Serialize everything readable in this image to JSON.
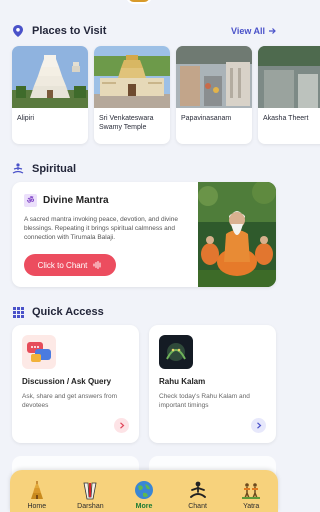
{
  "places_section": {
    "title": "Places to Visit",
    "view_all": "View All"
  },
  "places": [
    {
      "name": "Alipiri"
    },
    {
      "name": "Sri Venkateswara Swamy Temple"
    },
    {
      "name": "Papavinasanam"
    },
    {
      "name": "Akasha Theert"
    }
  ],
  "spiritual": {
    "title": "Spiritual",
    "mantra_title": "Divine Mantra",
    "om_symbol": "ॐ",
    "description": "A sacred mantra invoking peace, devotion, and divine blessings. Repeating it brings spiritual calmness and connection with Tirumala Balaji.",
    "button": "Click to Chant"
  },
  "quick_access": {
    "title": "Quick Access",
    "cards": [
      {
        "title": "Discussion / Ask Query",
        "desc": "Ask, share and get answers from devotees"
      },
      {
        "title": "Rahu Kalam",
        "desc": "Check today's Rahu Kalam and important timings"
      }
    ]
  },
  "nav": [
    {
      "label": "Home",
      "icon": "temple-icon"
    },
    {
      "label": "Darshan",
      "icon": "namam-icon"
    },
    {
      "label": "More",
      "icon": "globe-icon"
    },
    {
      "label": "Chant",
      "icon": "meditation-icon"
    },
    {
      "label": "Yatra",
      "icon": "pilgrims-icon"
    }
  ],
  "colors": {
    "accent": "#4a52c9",
    "chant_button": "#ec4d5f",
    "nav_bg": "#f7d27c",
    "nav_active": "#1a7a33"
  }
}
